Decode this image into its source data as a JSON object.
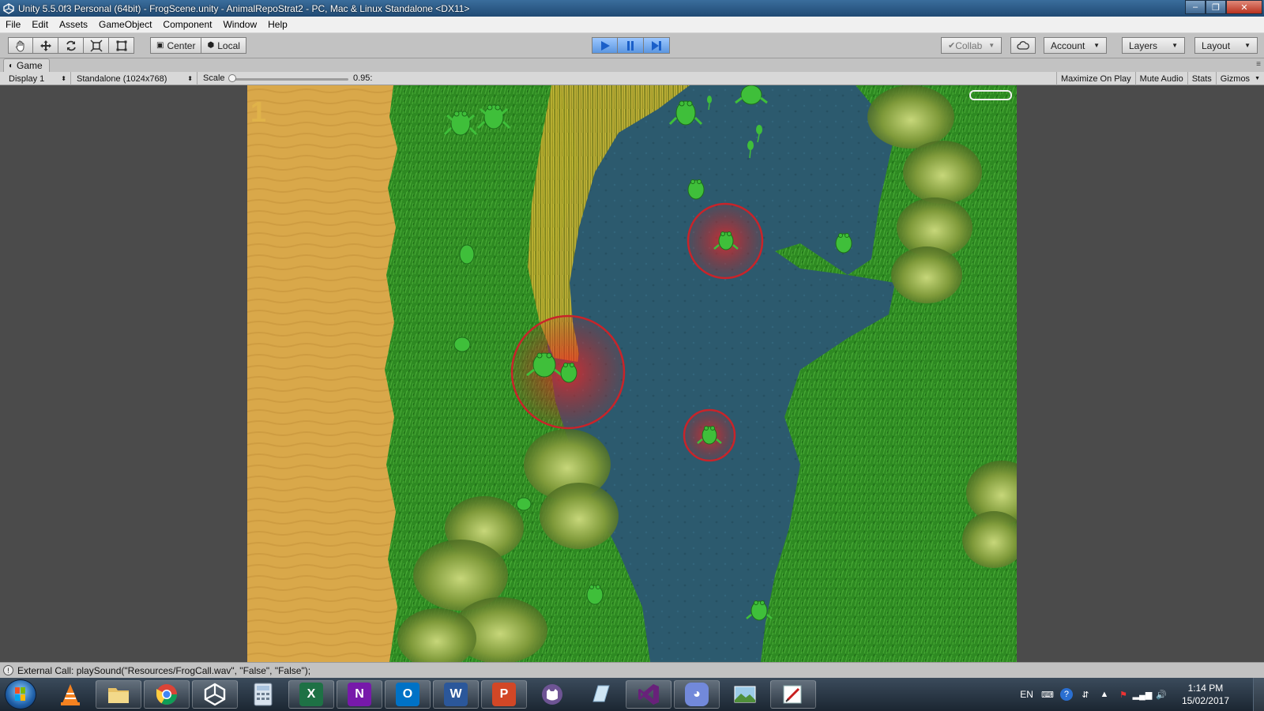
{
  "window": {
    "title": "Unity 5.5.0f3 Personal (64bit) - FrogScene.unity - AnimalRepoStrat2 - PC, Mac & Linux Standalone <DX11>",
    "minimize": "–",
    "restore": "❐",
    "close": "✕"
  },
  "menu": {
    "items": [
      "File",
      "Edit",
      "Assets",
      "GameObject",
      "Component",
      "Window",
      "Help"
    ]
  },
  "toolbar": {
    "tools": [
      "hand-tool",
      "move-tool",
      "rotate-tool",
      "scale-tool",
      "rect-tool"
    ],
    "pivot_center": "Center",
    "pivot_local": "Local",
    "collab": "Collab",
    "account": "Account",
    "layers": "Layers",
    "layout": "Layout"
  },
  "game_view": {
    "tab_label": "Game",
    "display": "Display 1",
    "resolution": "Standalone (1024x768)",
    "scale_label": "Scale",
    "scale_value": "0.95:",
    "scale_fraction": 0.0,
    "maximize_on_play": "Maximize On Play",
    "mute_audio": "Mute Audio",
    "stats": "Stats",
    "gizmos": "Gizmos",
    "score": "1"
  },
  "console": {
    "message": "External Call: playSound(\"Resources/FrogCall.wav\", \"False\", \"False\");"
  },
  "taskbar": {
    "apps": [
      "vlc",
      "file-explorer",
      "chrome",
      "unity",
      "calculator",
      "excel",
      "onenote",
      "outlook",
      "word",
      "powerpoint",
      "github-desktop",
      "blank-app",
      "visual-studio",
      "discord",
      "photo-viewer",
      "paint"
    ],
    "language": "EN",
    "time": "1:14 PM",
    "date": "15/02/2017"
  },
  "colors": {
    "sand": "#d9a84a",
    "grass": "#2f8a22",
    "water": "#2c5a6e",
    "reeds": "#b3a52a",
    "frog": "#3fbf3a",
    "ripple": "#c8242a"
  }
}
